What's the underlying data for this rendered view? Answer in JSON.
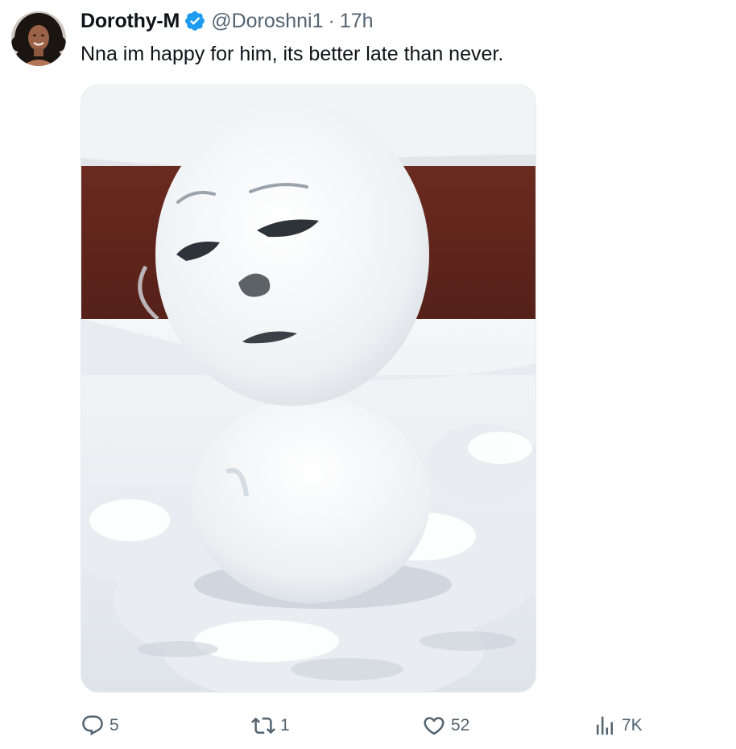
{
  "tweet": {
    "author": {
      "display_name": "Dorothy-M",
      "handle": "@Doroshni1",
      "verified": true,
      "verified_color": "#1d9bf0"
    },
    "separator": "·",
    "time": "17h",
    "text": "Nna im happy for him, its better late than never.",
    "media": {
      "icon": "snowman-photo"
    }
  },
  "actions": {
    "reply": {
      "icon": "reply-icon",
      "count": "5"
    },
    "repost": {
      "icon": "repost-icon",
      "count": "1"
    },
    "like": {
      "icon": "heart-icon",
      "count": "52"
    },
    "views": {
      "icon": "views-icon",
      "count": "7K"
    }
  },
  "colors": {
    "text_primary": "#0f1419",
    "text_secondary": "#536471",
    "accent": "#1d9bf0"
  }
}
